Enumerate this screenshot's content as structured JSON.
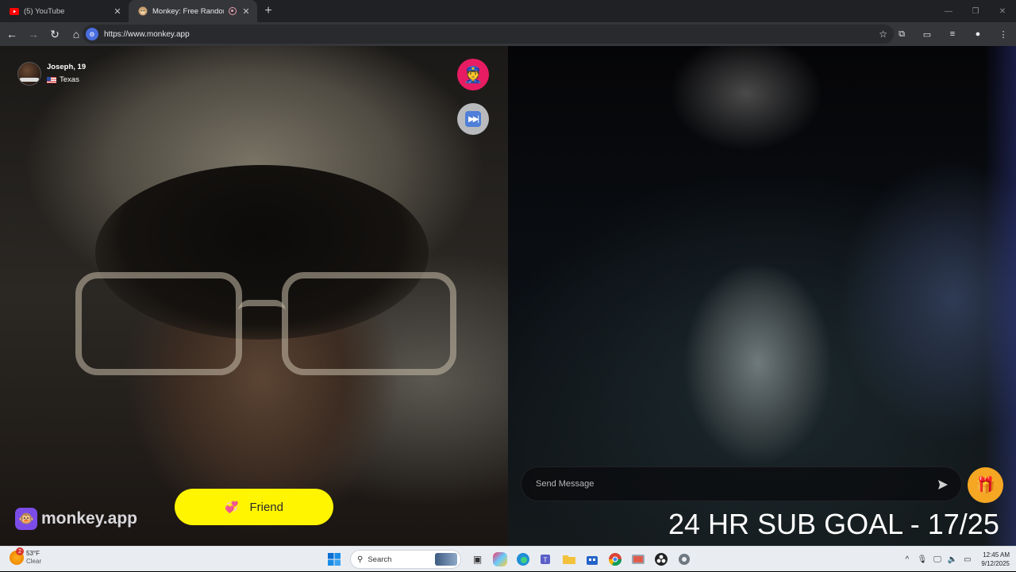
{
  "browser": {
    "tabs": [
      {
        "title": "(5) YouTube",
        "active": false,
        "favicon": "youtube-icon"
      },
      {
        "title": "Monkey: Free Random Vide",
        "active": true,
        "favicon": "monkey-icon"
      }
    ],
    "url": "https://www.monkey.app"
  },
  "peer": {
    "name_age": "Joseph, 19",
    "location": "Texas"
  },
  "controls": {
    "friend_label": "Friend",
    "message_placeholder": "Send Message"
  },
  "brand": {
    "name": "monkey.app",
    "color": "#7b4ce8"
  },
  "overlay": {
    "sub_goal": "24 HR SUB GOAL - 17/25"
  },
  "colors": {
    "report_button": "#e81c63",
    "friend_button": "#fff500",
    "gift_button": "#f5a623"
  },
  "taskbar": {
    "weather_temp": "53°F",
    "weather_desc": "Clear",
    "weather_badge": "2",
    "search_label": "Search",
    "time": "12:45 AM",
    "date": "9/12/2025"
  }
}
